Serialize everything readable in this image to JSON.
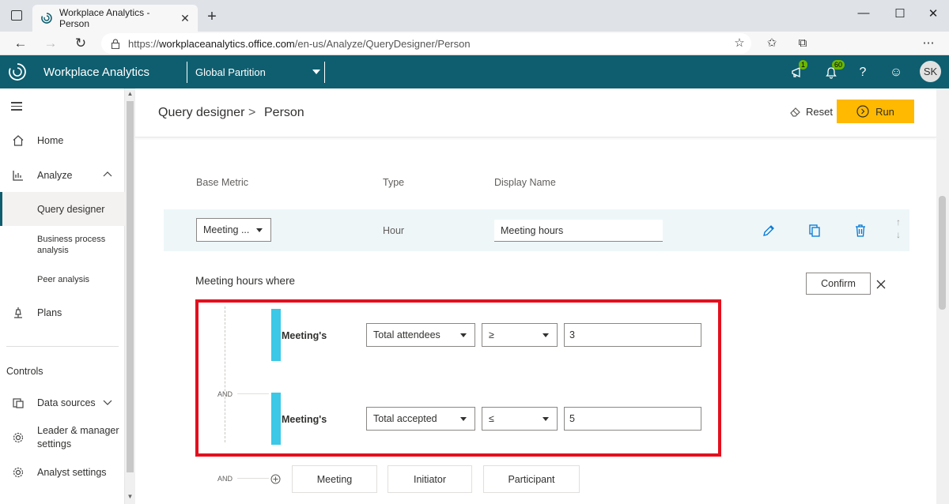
{
  "browser": {
    "tab_title": "Workplace Analytics - Person",
    "url_prefix": "https://",
    "url_host": "workplaceanalytics.office.com",
    "url_path": "/en-us/Analyze/QueryDesigner/Person"
  },
  "header": {
    "app_name": "Workplace Analytics",
    "partition": "Global Partition",
    "announcements_badge": "1",
    "notifications_badge": "60",
    "help": "?",
    "avatar_initials": "SK"
  },
  "sidebar": {
    "items": [
      {
        "label": "Home"
      },
      {
        "label": "Analyze"
      },
      {
        "label": "Query designer"
      },
      {
        "label": "Business process analysis"
      },
      {
        "label": "Peer analysis"
      },
      {
        "label": "Plans"
      }
    ],
    "controls_heading": "Controls",
    "controls_items": [
      {
        "label": "Data sources"
      },
      {
        "label": "Leader & manager settings"
      },
      {
        "label": "Analyst settings"
      }
    ]
  },
  "page": {
    "breadcrumb_parent": "Query designer",
    "breadcrumb_sep": ">",
    "breadcrumb_current": "Person",
    "reset_label": "Reset",
    "run_label": "Run"
  },
  "metric_table": {
    "col_base_metric": "Base Metric",
    "col_type": "Type",
    "col_display_name": "Display Name",
    "base_metric_value": "Meeting ...",
    "type_value": "Hour",
    "display_name_value": "Meeting hours"
  },
  "filter": {
    "where_label": "Meeting hours where",
    "confirm_label": "Confirm",
    "and_label": "AND",
    "conditions": [
      {
        "entity": "Meeting's",
        "attribute": "Total attendees",
        "operator": "≥",
        "value": "3"
      },
      {
        "entity": "Meeting's",
        "attribute": "Total accepted",
        "operator": "≤",
        "value": "5"
      }
    ],
    "add_buttons": [
      "Meeting",
      "Initiator",
      "Participant"
    ]
  },
  "colors": {
    "header_bg": "#0e5e6f",
    "run_button": "#ffb900",
    "highlight_box": "#e3101e",
    "condition_bar": "#3cc8e6"
  }
}
